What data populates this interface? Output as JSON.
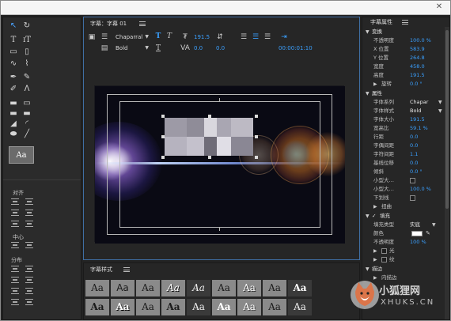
{
  "titler": {
    "tab": "字幕：字幕 01",
    "font_family": "Chaparral",
    "font_style": "Bold",
    "font_size": "191.5",
    "kerning": "0.0",
    "leading": "0.0",
    "timecode": "00:00:01:10"
  },
  "tools": {
    "shape_preview": "Aa",
    "align_label": "对齐",
    "center_label": "中心",
    "distribute_label": "分布"
  },
  "styles": {
    "tab": "字幕样式",
    "cells": [
      "Aa",
      "Aa",
      "Aa",
      "Aa",
      "Aa",
      "Aa",
      "Aa",
      "Aa",
      "Aa",
      "Aa",
      "Aa",
      "Aa",
      "Aa",
      "Aa",
      "Aa",
      "Aa",
      "Aa",
      "Aa"
    ]
  },
  "props": {
    "tab": "字幕属性",
    "transform_header": "变换",
    "opacity_label": "不透明度",
    "opacity_value": "100.0 %",
    "x_label": "X 位置",
    "x_value": "583.9",
    "y_label": "Y 位置",
    "y_value": "264.8",
    "width_label": "宽度",
    "width_value": "458.0",
    "height_label": "高度",
    "height_value": "191.5",
    "rotation_label": "旋转",
    "rotation_value": "0.0 °",
    "properties_header": "属性",
    "family_label": "字体系列",
    "family_value": "Chapar",
    "style_label": "字体样式",
    "style_value": "Bold",
    "size_label": "字体大小",
    "size_value": "191.5",
    "aspect_label": "宽高比",
    "aspect_value": "59.1 %",
    "leading_label": "行距",
    "leading_value": "0.0",
    "kerning_label": "字偶间距",
    "kerning_value": "0.0",
    "tracking_label": "字符间距",
    "tracking_value": "1.1",
    "baseline_label": "基线位移",
    "baseline_value": "0.0",
    "slant_label": "倾斜",
    "slant_value": "0.0 °",
    "smallcaps_label": "小型大…",
    "smallcaps_size_label": "小型大…",
    "smallcaps_size_value": "100.0 %",
    "underline_label": "下划线",
    "distort_label": "扭曲",
    "fill_label": "填充",
    "fill_type_label": "填充类型",
    "fill_type_value": "实底",
    "color_label": "颜色",
    "fill_opacity_label": "不透明度",
    "fill_opacity_value": "100 %",
    "partial_1": "光",
    "partial_2": "纹",
    "partial_3": "描边",
    "partial_4": "内描边"
  },
  "watermark": {
    "name": "小狐狸网",
    "domain": "XHUKS.CN"
  }
}
